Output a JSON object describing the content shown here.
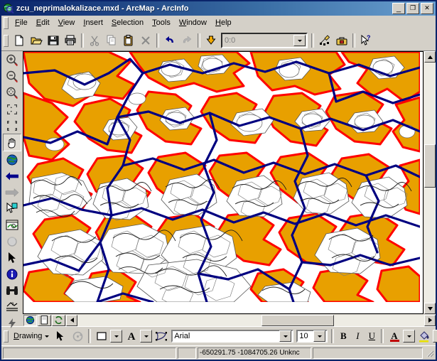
{
  "window": {
    "title": "zcu_neprimalokalizace.mxd - ArcMap - ArcInfo",
    "icon": "arcmap-globe-icon",
    "minimize_label": "_",
    "maximize_label": "❐",
    "close_label": "✕"
  },
  "menubar": {
    "items": [
      {
        "label": "File",
        "accel": "F"
      },
      {
        "label": "Edit",
        "accel": "E"
      },
      {
        "label": "View",
        "accel": "V"
      },
      {
        "label": "Insert",
        "accel": "I"
      },
      {
        "label": "Selection",
        "accel": "S"
      },
      {
        "label": "Tools",
        "accel": "T"
      },
      {
        "label": "Window",
        "accel": "W"
      },
      {
        "label": "Help",
        "accel": "H"
      }
    ]
  },
  "standard_toolbar": {
    "buttons": [
      {
        "name": "new-document-icon",
        "tooltip": "New Map File"
      },
      {
        "name": "open-folder-icon",
        "tooltip": "Open"
      },
      {
        "name": "save-disk-icon",
        "tooltip": "Save"
      },
      {
        "name": "print-icon",
        "tooltip": "Print"
      },
      {
        "name": "cut-scissors-icon",
        "tooltip": "Cut"
      },
      {
        "name": "copy-icon",
        "tooltip": "Copy"
      },
      {
        "name": "paste-clipboard-icon",
        "tooltip": "Paste"
      },
      {
        "name": "delete-x-icon",
        "tooltip": "Delete"
      },
      {
        "name": "undo-arrow-icon",
        "tooltip": "Undo"
      },
      {
        "name": "redo-arrow-icon",
        "tooltip": "Redo"
      },
      {
        "name": "add-data-icon",
        "tooltip": "Add Data"
      },
      {
        "name": "editor-toolbar-icon",
        "tooltip": "Editor Toolbar"
      },
      {
        "name": "arctoolbox-icon",
        "tooltip": "Show/Hide ArcToolbox Window"
      },
      {
        "name": "whats-this-help-icon",
        "tooltip": "What's This?"
      }
    ],
    "scale": {
      "value": "0:0",
      "placeholder": "0:0",
      "disabled": true
    }
  },
  "tools_toolbar": {
    "buttons": [
      {
        "name": "zoom-in-icon",
        "tooltip": "Zoom In"
      },
      {
        "name": "zoom-out-icon",
        "tooltip": "Zoom Out"
      },
      {
        "name": "pan-zoom-icon",
        "tooltip": "Continuous Zoom And Pan"
      },
      {
        "name": "fixed-zoom-in-icon",
        "tooltip": "Fixed Zoom In"
      },
      {
        "name": "fixed-zoom-out-icon",
        "tooltip": "Fixed Zoom Out"
      },
      {
        "name": "pan-hand-icon",
        "tooltip": "Pan",
        "selected": true
      },
      {
        "name": "full-extent-globe-icon",
        "tooltip": "Full Extent"
      },
      {
        "name": "back-extent-icon",
        "tooltip": "Go Back To Previous Extent"
      },
      {
        "name": "forward-extent-icon",
        "tooltip": "Go To Next Extent"
      },
      {
        "name": "select-features-icon",
        "tooltip": "Select Features"
      },
      {
        "name": "select-by-graphics-icon",
        "tooltip": "Select Elements"
      },
      {
        "name": "clear-selection-icon",
        "tooltip": "Clear Selected Features"
      },
      {
        "name": "select-elements-arrow-icon",
        "tooltip": "Select Elements"
      },
      {
        "name": "identify-info-icon",
        "tooltip": "Identify"
      },
      {
        "name": "find-binoculars-icon",
        "tooltip": "Find"
      },
      {
        "name": "measure-icon",
        "tooltip": "Measure"
      },
      {
        "name": "hyperlink-lightning-icon",
        "tooltip": "Hyperlink"
      }
    ]
  },
  "map_view": {
    "tabs": [
      {
        "name": "data-view-tab",
        "icon": "globe-icon",
        "active": true
      },
      {
        "name": "layout-view-tab",
        "icon": "page-icon",
        "active": false
      },
      {
        "name": "refresh-view-button",
        "icon": "refresh-icon",
        "active": false
      }
    ],
    "layers": {
      "orange_fill": "#E8A000",
      "orange_outline": "#FF0000",
      "white_fill": "#FFFFFF",
      "white_outline": "#000000",
      "line_color": "#000080",
      "background": "#FFFFFF"
    }
  },
  "drawing_toolbar": {
    "menu_label": "Drawing",
    "menu_accel": "D",
    "buttons": [
      {
        "name": "select-elements-icon",
        "tooltip": "Select Elements"
      },
      {
        "name": "rotate-element-icon",
        "tooltip": "Rotate"
      },
      {
        "name": "new-rectangle-icon",
        "tooltip": "New Rectangle"
      },
      {
        "name": "new-text-icon",
        "tooltip": "New Text"
      },
      {
        "name": "nudge-icon",
        "tooltip": "Drawing Tools"
      }
    ],
    "font_name": "Arial",
    "font_size": "10",
    "bold_label": "B",
    "italic_label": "I",
    "underline_label": "U",
    "font_color_label": "A",
    "fill_color_name": "fill-color-icon"
  },
  "statusbar": {
    "left_message": "",
    "coordinates": "-650291.75  -1084705.26 Unknc",
    "right_message": ""
  }
}
